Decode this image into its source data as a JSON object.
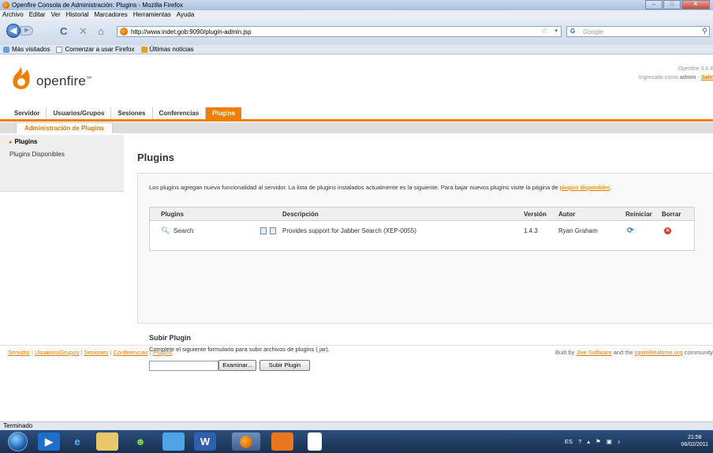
{
  "window": {
    "title": "Openfire Consola de Administración: Plugins - Mozilla Firefox",
    "min_glyph": "–",
    "max_glyph": "□",
    "close_glyph": "X"
  },
  "menubar": [
    "Archivo",
    "Editar",
    "Ver",
    "Historial",
    "Marcadores",
    "Herramientas",
    "Ayuda"
  ],
  "navbar": {
    "back_glyph": "◀",
    "forward_glyph": "▶",
    "reload_glyph": "C",
    "stop_glyph": "✕",
    "home_glyph": "⌂",
    "url": "http://www.indet.gob:9090/plugin-admin.jsp",
    "search_engine": "G",
    "search_placeholder": "Google"
  },
  "bookmarks": [
    "Más visitados",
    "Comenzar a usar Firefox",
    "Últimas noticias"
  ],
  "header": {
    "logo_text": "openfire",
    "version": "Openfire 3.6.4",
    "logged_in_prefix": "Ingresado como",
    "user": "admin",
    "separator": " - ",
    "logout": "Salir"
  },
  "tabs": [
    "Servidor",
    "Usuarios/Grupos",
    "Sesiones",
    "Conferencias",
    "Plugins"
  ],
  "active_tab": "Plugins",
  "subtab": "Administración de Plugins",
  "sidebar": {
    "items": [
      "Plugins",
      "Plugins Disponibles"
    ]
  },
  "main": {
    "title": "Plugins",
    "intro": "Los plugins agregan nueva funcionalidad al servidor. La lista de plugins instalados actualmente es la siguiente. Para bajar nuevos plugins visite la página de ",
    "intro_link": "plugins disponibles",
    "intro_end": ".",
    "table": {
      "headers": [
        "Plugins",
        "Descripción",
        "Versión",
        "Autor",
        "Reiniciar",
        "Borrar"
      ],
      "rows": [
        {
          "name": "Search",
          "description": "Provides support for Jabber Search (XEP-0055)",
          "version": "1.4.3",
          "author": "Ryan Graham"
        }
      ]
    },
    "upload": {
      "title": "Subir Plugin",
      "description": "Complete el siguiente formulario para subir archivos de plugins (.jar).",
      "browse_label": "Examinar...",
      "submit_label": "Subir Plugin"
    }
  },
  "footer": {
    "links": [
      "Servidor",
      "Usuarios/Grupos",
      "Sesiones",
      "Conferencias",
      "Plugins"
    ],
    "separator": "|",
    "built_by": "Built by",
    "jive": "Jive Software",
    "and_the": "and the",
    "ignite": "IgniteRealtime.org",
    "community": "community"
  },
  "status": "Terminado",
  "tray": {
    "lang": "ES",
    "time": "21:58",
    "date": "06/02/2011"
  },
  "colors": {
    "accent": "#f07e00",
    "link": "#e07a00",
    "taskbar": "#1f3d63"
  }
}
